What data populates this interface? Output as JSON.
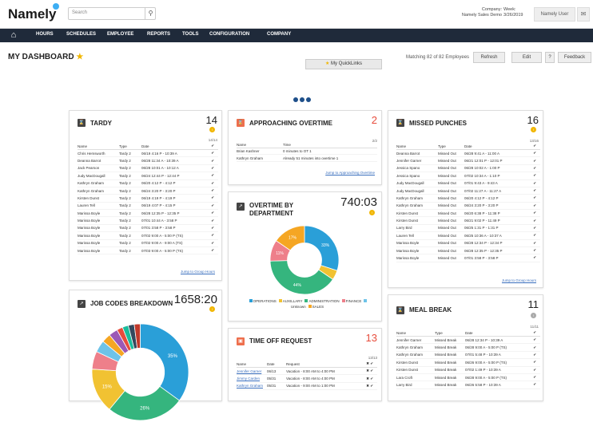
{
  "header": {
    "logo": "Namely",
    "search_placeholder": "Search",
    "company_label": "Company:",
    "company_value": "Namely Sales Demo",
    "week_label": "Week:",
    "week_value": "3/26/2019",
    "user": "Namely User"
  },
  "nav": {
    "items": [
      "HOURS",
      "SCHEDULES",
      "EMPLOYEE",
      "REPORTS",
      "TOOLS",
      "CONFIGURATION",
      "COMPANY"
    ],
    "quicklinks": "My QuickLinks"
  },
  "dashboard": {
    "title": "MY DASHBOARD",
    "matching": "Matching 82 of 82 Employees",
    "refresh": "Refresh",
    "edit": "Edit",
    "help": "?",
    "feedback": "Feedback"
  },
  "tardy": {
    "title": "TARDY",
    "count": "14",
    "badge": "!",
    "fraction": "14/14",
    "columns": [
      "Name",
      "Type",
      "Date"
    ],
    "rows": [
      [
        "Chris Hemsworth",
        "Tardy 2",
        "06/19 4:16 P - 10:39 A"
      ],
      [
        "Deanna Barrot",
        "Tardy 2",
        "06/28 11:34 A - 10:39 A"
      ],
      [
        "Jack Pearson",
        "Tardy 2",
        "06/28 10:01 A - 10:12 A"
      ],
      [
        "Judy MacDougall",
        "Tardy 2",
        "06/24 12:44 P - 12:44 P"
      ],
      [
        "Kathryn Graham",
        "Tardy 2",
        "06/20 4:12 P - 4:12 P"
      ],
      [
        "Kathryn Graham",
        "Tardy 2",
        "06/24 3:20 P - 3:20 P"
      ],
      [
        "Kirsten Dunst",
        "Tardy 2",
        "06/19 4:19 P - 4:19 P"
      ],
      [
        "Lauren Tell",
        "Tardy 2",
        "06/19 4:07 P - 4:15 P"
      ],
      [
        "Marissa Boyle",
        "Tardy 2",
        "06/28 12:35 P - 12:35 P"
      ],
      [
        "Marissa Boyle",
        "Tardy 2",
        "07/01 10:44 A - 3:58 P"
      ],
      [
        "Marissa Boyle",
        "Tardy 2",
        "07/01 3:58 P - 3:58 P"
      ],
      [
        "Marissa Boyle",
        "Tardy 2",
        "07/02 9:00 A - 5:00 P (TS)"
      ],
      [
        "Marissa Boyle",
        "Tardy 2",
        "07/02 9:00 A - 9:00 A (TS)"
      ],
      [
        "Marissa Boyle",
        "Tardy 2",
        "07/03 9:00 A - 5:00 P (TS)"
      ]
    ],
    "jump": "Jump to Group Hours"
  },
  "overtime": {
    "title": "APPROACHING OVERTIME",
    "count": "2",
    "fraction": "2/2",
    "columns": [
      "Name",
      "Time"
    ],
    "rows": [
      [
        "Brian Kashner",
        "0 minutes to OT 1"
      ],
      [
        "Kathryn Graham",
        "Already 51 minutes into overtime 1"
      ]
    ],
    "jump": "Jump to Approaching Overtime"
  },
  "ot_dept": {
    "title": "OVERTIME BY DEPARTMENT",
    "count": "740:03",
    "badge": "!",
    "chart_data": {
      "type": "pie",
      "categories": [
        "OPERATIONS",
        "AUXILLARY",
        "ADMINISTRATION",
        "FINANCE",
        "Unknown",
        "SALES"
      ],
      "values": [
        33,
        5,
        44,
        11,
        0,
        17
      ],
      "slice_labels": [
        "33%",
        "",
        "44%",
        "11%",
        "",
        "17%"
      ],
      "colors": [
        "#2a9fd8",
        "#f1c232",
        "#35b57e",
        "#ee7f8a",
        "#6ec3e8",
        "#f5a623"
      ]
    }
  },
  "missed": {
    "title": "MISSED PUNCHES",
    "count": "16",
    "badge": "!",
    "fraction": "13/16",
    "columns": [
      "Name",
      "Type",
      "Date"
    ],
    "rows": [
      [
        "Deanna Barrot",
        "Missed Out",
        "06/28 9:41 A - 11:00 A"
      ],
      [
        "Jennifer Garner",
        "Missed Out",
        "06/21 12:01 P - 12:01 P"
      ],
      [
        "Jessica Spano",
        "Missed Out",
        "06/28 10:02 A - 1:00 P"
      ],
      [
        "Jessica Spano",
        "Missed Out",
        "07/02 10:34 A - 1:10 P"
      ],
      [
        "Judy MacDougall",
        "Missed Out",
        "07/01 9:43 A - 9:43 A"
      ],
      [
        "Judy MacDougall",
        "Missed Out",
        "07/02 11:27 A - 11:27 A"
      ],
      [
        "Kathryn Graham",
        "Missed Out",
        "06/20 4:12 P - 4:12 P"
      ],
      [
        "Kathryn Graham",
        "Missed Out",
        "06/24 3:20 P - 3:20 P"
      ],
      [
        "Kirsten Dunst",
        "Missed Out",
        "06/20 6:38 P - 11:38 P"
      ],
      [
        "Kirsten Dunst",
        "Missed Out",
        "06/21 9:02 P - 11:49 P"
      ],
      [
        "Larry Bird",
        "Missed Out",
        "06/25 1:31 P - 1:31 P"
      ],
      [
        "Lauren Tell",
        "Missed Out",
        "06/25 10:36 A - 10:37 A"
      ],
      [
        "Marissa Boyle",
        "Missed Out",
        "06/28 12:34 P - 12:34 P"
      ],
      [
        "Marissa Boyle",
        "Missed Out",
        "06/28 12:35 P - 12:35 P"
      ],
      [
        "Marissa Boyle",
        "Missed Out",
        "07/01 3:58 P - 3:58 P"
      ]
    ],
    "jump": "Jump to Group Hours"
  },
  "jobcodes": {
    "title": "JOB CODES BREAKDOWN",
    "count": "1658:20",
    "badge": "!",
    "chart_data": {
      "type": "pie",
      "values": [
        35,
        26,
        15,
        6,
        4,
        3,
        3,
        2,
        2,
        2,
        2
      ],
      "slice_labels": [
        "35%",
        "26%",
        "15%",
        "",
        "",
        "",
        "",
        "",
        "",
        "",
        ""
      ],
      "colors": [
        "#2a9fd8",
        "#35b57e",
        "#f1c232",
        "#ee7f8a",
        "#6ec3e8",
        "#f5a623",
        "#9b59b6",
        "#e74c3c",
        "#1abc9c",
        "#34495e",
        "#c0392b"
      ]
    }
  },
  "timeoff": {
    "title": "TIME OFF REQUEST",
    "count": "13",
    "fraction": "13/13",
    "columns": [
      "Name",
      "Date",
      "Request"
    ],
    "rows": [
      [
        "Jennifer Garner",
        "06/13",
        "Vacation - 8:00 AM to 4:00 PM"
      ],
      [
        "Jimmy Carden",
        "05/31",
        "Vacation - 8:00 AM to 4:00 PM"
      ],
      [
        "Kathryn Graham",
        "05/31",
        "Vacation - 9:00 AM to 1:00 PM"
      ]
    ]
  },
  "meal": {
    "title": "MEAL BREAK",
    "count": "11",
    "badge": "!",
    "fraction": "11/11",
    "columns": [
      "Name",
      "Type",
      "Date"
    ],
    "rows": [
      [
        "Jennifer Garner",
        "Missed Break",
        "06/28 12:34 P - 10:39 A"
      ],
      [
        "Kathryn Graham",
        "Missed Break",
        "06/28 9:00 A - 5:00 P (TS)"
      ],
      [
        "Kathryn Graham",
        "Missed Break",
        "07/01 5:48 P - 10:39 A"
      ],
      [
        "Kirsten Dunst",
        "Missed Break",
        "06/26 9:00 A - 5:00 P (TS)"
      ],
      [
        "Kirsten Dunst",
        "Missed Break",
        "07/02 1:49 P - 10:39 A"
      ],
      [
        "Lara Croft",
        "Missed Break",
        "06/28 9:00 A - 5:00 P (TS)"
      ],
      [
        "Larry Bird",
        "Missed Break",
        "06/26 5:58 P - 10:39 A"
      ]
    ]
  }
}
